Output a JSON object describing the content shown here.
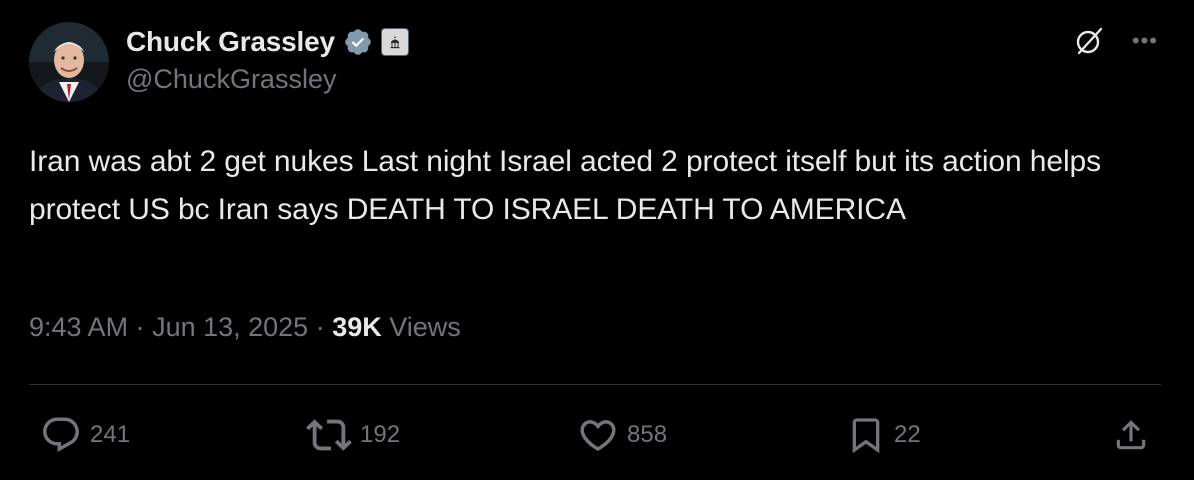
{
  "author": {
    "display_name": "Chuck Grassley",
    "handle": "@ChuckGrassley",
    "verified_color": "#829aab",
    "avatar_icon": "profile-photo"
  },
  "tweet": {
    "text": "Iran was abt 2 get nukes Last night Israel acted 2 protect itself but its action helps protect US bc Iran says DEATH TO ISRAEL DEATH TO AMERICA",
    "time": "9:43 AM",
    "separator": " · ",
    "date": "Jun 13, 2025",
    "views_count": "39K",
    "views_label": " Views"
  },
  "actions": {
    "replies": "241",
    "reposts": "192",
    "likes": "858",
    "bookmarks": "22"
  },
  "icons": {
    "reply": "reply-icon",
    "repost": "repost-icon",
    "like": "heart-icon",
    "bookmark": "bookmark-icon",
    "share": "share-icon",
    "grok": "grok-icon",
    "more": "more-icon"
  },
  "colors": {
    "background": "#000000",
    "text_primary": "#e7e9ea",
    "text_secondary": "#71767b",
    "divider": "#2f3336"
  }
}
